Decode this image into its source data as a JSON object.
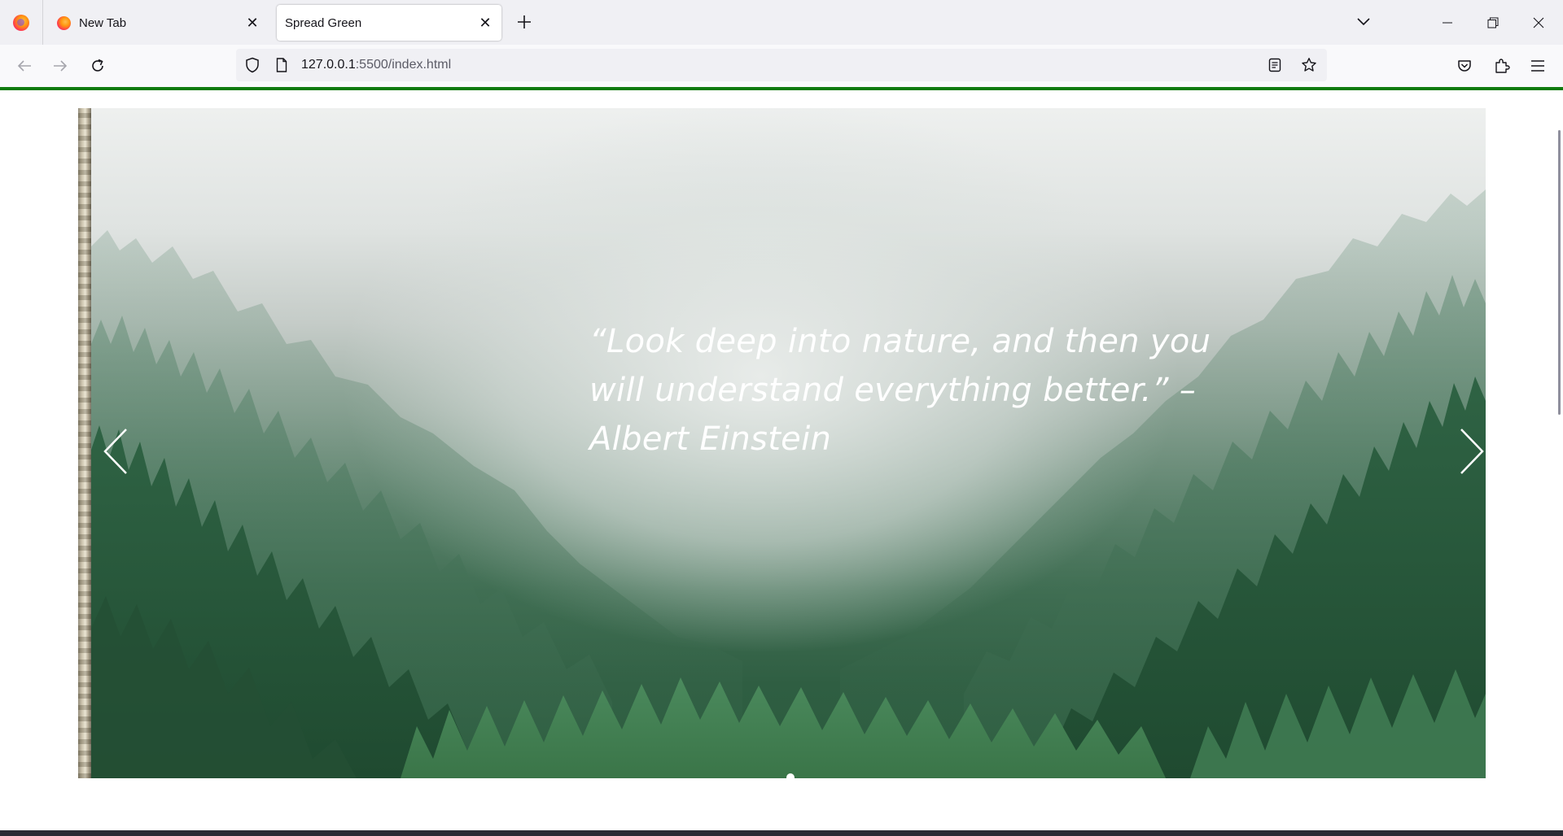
{
  "browser": {
    "tabs": [
      {
        "title": "New Tab",
        "active": false
      },
      {
        "title": "Spread Green",
        "active": true
      }
    ],
    "url_host": "127.0.0.1",
    "url_rest": ":5500/index.html",
    "icons": {
      "firefox_menu": "firefox-logo-icon",
      "back": "arrow-left-icon",
      "forward": "arrow-right-icon",
      "reload": "reload-icon",
      "tracking": "shield-icon",
      "page": "page-icon",
      "reader": "reader-view-icon",
      "bookmark": "star-icon",
      "pocket": "pocket-icon",
      "extensions": "puzzle-icon",
      "menu": "hamburger-icon"
    }
  },
  "page": {
    "accent_color": "#0e7a0d",
    "carousel": {
      "quote": "“Look deep into nature, and then you will understand everything better.” – Albert Einstein",
      "active_index": 0,
      "indicator_count": 1,
      "prev_icon": "chevron-left-icon",
      "next_icon": "chevron-right-icon"
    }
  }
}
